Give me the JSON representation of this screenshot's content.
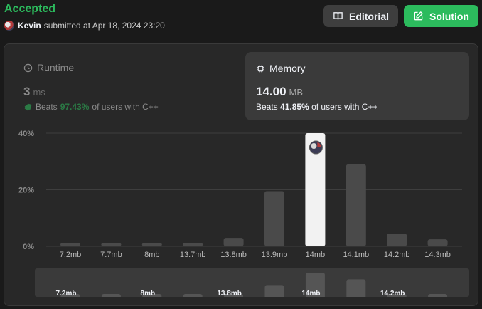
{
  "header": {
    "status": "Accepted",
    "user": "Kevin",
    "submitted_text": "submitted at Apr 18, 2024 23:20",
    "editorial_label": "Editorial",
    "solution_label": "Solution"
  },
  "runtime": {
    "title": "Runtime",
    "value": "3",
    "unit": "ms",
    "beats_prefix": "Beats",
    "beats_pct": "97.43%",
    "beats_suffix": "of users with C++"
  },
  "memory": {
    "title": "Memory",
    "value": "14.00",
    "unit": "MB",
    "beats_prefix": "Beats",
    "beats_pct": "41.85%",
    "beats_suffix": "of users with C++"
  },
  "colors": {
    "accepted": "#2cbb5d",
    "bar": "#4a4a4a",
    "highlight_bar": "#f2f2f2",
    "grid": "#3e3e3e"
  },
  "chart_data": {
    "type": "bar",
    "categories": [
      "7.2mb",
      "7.7mb",
      "8mb",
      "13.7mb",
      "13.8mb",
      "13.9mb",
      "14mb",
      "14.1mb",
      "14.2mb",
      "14.3mb"
    ],
    "values": [
      1.2,
      1.2,
      1.2,
      1.2,
      3.0,
      19.5,
      40.0,
      29.0,
      4.5,
      2.5
    ],
    "highlight_index": 6,
    "y_tick_labels": [
      "0%",
      "20%",
      "40%"
    ],
    "y_ticks": [
      0,
      20,
      40
    ],
    "ylim": [
      0,
      40
    ],
    "grid": true,
    "minimap": {
      "labels": [
        "7.2mb",
        "8mb",
        "13.8mb",
        "14mb",
        "14.2mb"
      ],
      "label_indices": [
        0,
        2,
        4,
        6,
        8
      ]
    }
  }
}
